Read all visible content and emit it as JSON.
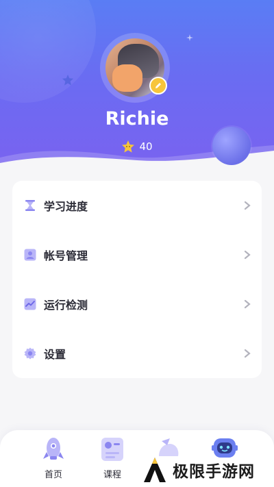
{
  "colors": {
    "header_top": "#5a7df4",
    "header_bottom": "#7a62f0",
    "badge": "#f7c53b",
    "icon_purple": "#8b86f0",
    "text_dark": "#2b2b36"
  },
  "profile": {
    "username": "Richie",
    "star_count": "40",
    "avatar_icon": "avatar-image",
    "edit_icon": "pencil-icon"
  },
  "menu": {
    "items": [
      {
        "label": "学习进度",
        "icon": "hourglass-icon"
      },
      {
        "label": "帐号管理",
        "icon": "user-icon"
      },
      {
        "label": "运行检测",
        "icon": "chart-line-icon"
      },
      {
        "label": "设置",
        "icon": "gear-icon"
      }
    ]
  },
  "tabbar": {
    "tabs": [
      {
        "label": "首页",
        "icon": "rocket-icon"
      },
      {
        "label": "课程",
        "icon": "course-icon"
      },
      {
        "label": "",
        "icon": "satellite-icon"
      },
      {
        "label": "",
        "icon": "robot-icon"
      }
    ]
  },
  "watermark": {
    "text": "极限手游网"
  }
}
